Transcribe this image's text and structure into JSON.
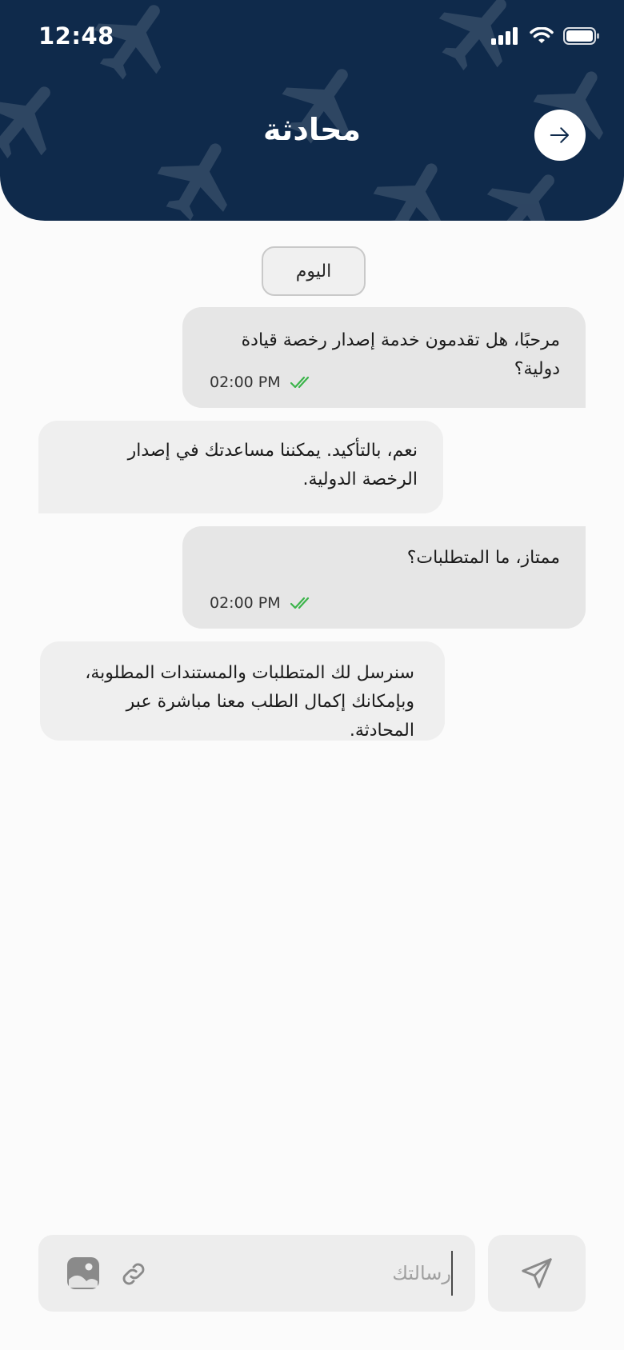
{
  "status_bar": {
    "time": "12:48"
  },
  "header": {
    "title": "محادثة"
  },
  "day_chip": {
    "label": "اليوم"
  },
  "messages": [
    {
      "direction": "outgoing",
      "text": "مرحبًا، هل تقدمون خدمة إصدار رخصة قيادة دولية؟",
      "time": "02:00 PM",
      "read": true
    },
    {
      "direction": "incoming",
      "text": "نعم، بالتأكيد. يمكننا مساعدتك في إصدار الرخصة الدولية."
    },
    {
      "direction": "outgoing",
      "text": "ممتاز، ما المتطلبات؟",
      "time": "02:00 PM",
      "read": true
    },
    {
      "direction": "incoming",
      "text": "سنرسل لك المتطلبات والمستندات المطلوبة، وبإمكانك إكمال الطلب معنا مباشرة عبر المحادثة."
    }
  ],
  "composer": {
    "placeholder": "رسالتك",
    "value": ""
  },
  "icons": {
    "back": "arrow-right-icon",
    "attach": "link-icon",
    "image": "image-icon",
    "send": "send-icon",
    "read": "double-check-icon"
  },
  "colors": {
    "header_bg": "#0f2a4b",
    "outgoing_bubble": "#e6e6e6",
    "incoming_bubble": "#efefef",
    "read_tick": "#3bb44a"
  }
}
